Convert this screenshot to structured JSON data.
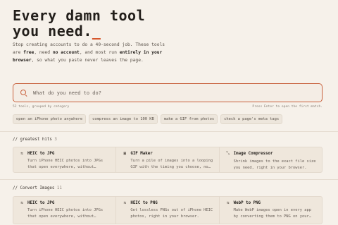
{
  "hero": {
    "title_line1": "Every damn tool",
    "title_line2": "you need.",
    "cursor": "_",
    "desc_1": "Stop creating accounts to do a 40-second job. These tools are ",
    "desc_free": "free",
    "desc_2": ", need ",
    "desc_noaccount": "no account",
    "desc_3": ", and most run ",
    "desc_browser": "entirely in your browser",
    "desc_4": ", so what you paste never leaves the page."
  },
  "search": {
    "placeholder": "What do you need to do?",
    "tools_count": "52 tools, grouped by category",
    "hint": "Press Enter to open the first match."
  },
  "suggestions": [
    "open an iPhone photo anywhere",
    "compress an image to 100 KB",
    "make a GIF from photos",
    "check a page's meta tags"
  ],
  "sections": [
    {
      "title": "greatest hits",
      "count": "3",
      "cards": [
        {
          "icon": "⇆",
          "title": "HEIC to JPG",
          "desc": "Turn iPhone HEIC photos into JPGs that open everywhere, without…"
        },
        {
          "icon": "▣",
          "title": "GIF Maker",
          "desc": "Turn a pile of images into a looping GIF with the timing you choose, no…"
        },
        {
          "icon": "⤡",
          "title": "Image Compressor",
          "desc": "Shrink images to the exact file size you need, right in your browser."
        }
      ]
    },
    {
      "title": "Convert Images",
      "count": "11",
      "cards": [
        {
          "icon": "⇆",
          "title": "HEIC to JPG",
          "desc": "Turn iPhone HEIC photos into JPGs that open everywhere, without…"
        },
        {
          "icon": "⇆",
          "title": "HEIC to PNG",
          "desc": "Get lossless PNGs out of iPhone HEIC photos, right in your browser."
        },
        {
          "icon": "⇆",
          "title": "WebP to PNG",
          "desc": "Make WebP images open in every app by converting them to PNG on your…"
        }
      ]
    }
  ],
  "colors": {
    "accent": "#c8613d",
    "background": "#f6f1ea",
    "cursor": "#d24a1d"
  }
}
